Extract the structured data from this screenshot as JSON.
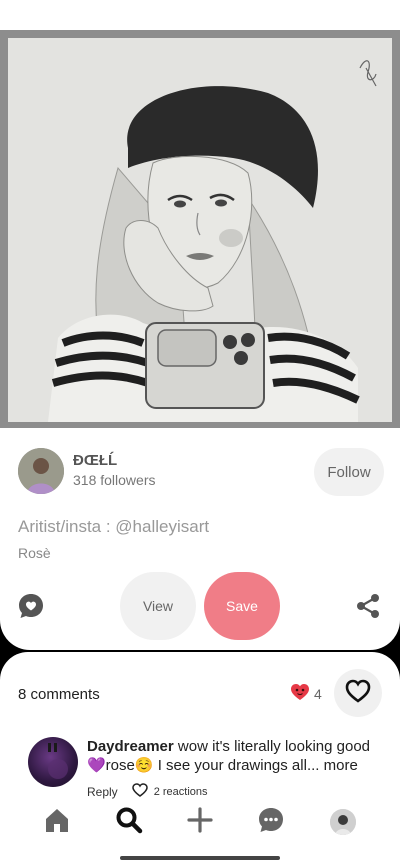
{
  "pin": {
    "title": "Aritist/insta : @halleyisart",
    "subtitle": "Rosè",
    "view_label": "View",
    "save_label": "Save"
  },
  "creator": {
    "name": "ÐŒŁĹ",
    "followers": "318 followers",
    "follow_label": "Follow"
  },
  "comments": {
    "count_label": "8 comments",
    "reaction_count": "4",
    "items": [
      {
        "author": "Daydreamer",
        "text": "wow it's literally looking good 💜rose☺️ I see your drawings all...",
        "more_label": "more",
        "reply_label": "Reply",
        "reactions_label": "2 reactions"
      }
    ]
  },
  "colors": {
    "save_accent": "#f07d87",
    "reaction_heart": "#e63946"
  },
  "icons": {
    "comment": "comment-bubble-heart-icon",
    "share": "share-icon",
    "like": "heart-outline-icon",
    "nav": [
      "home-icon",
      "search-icon",
      "plus-icon",
      "messages-icon",
      "profile-avatar"
    ]
  }
}
